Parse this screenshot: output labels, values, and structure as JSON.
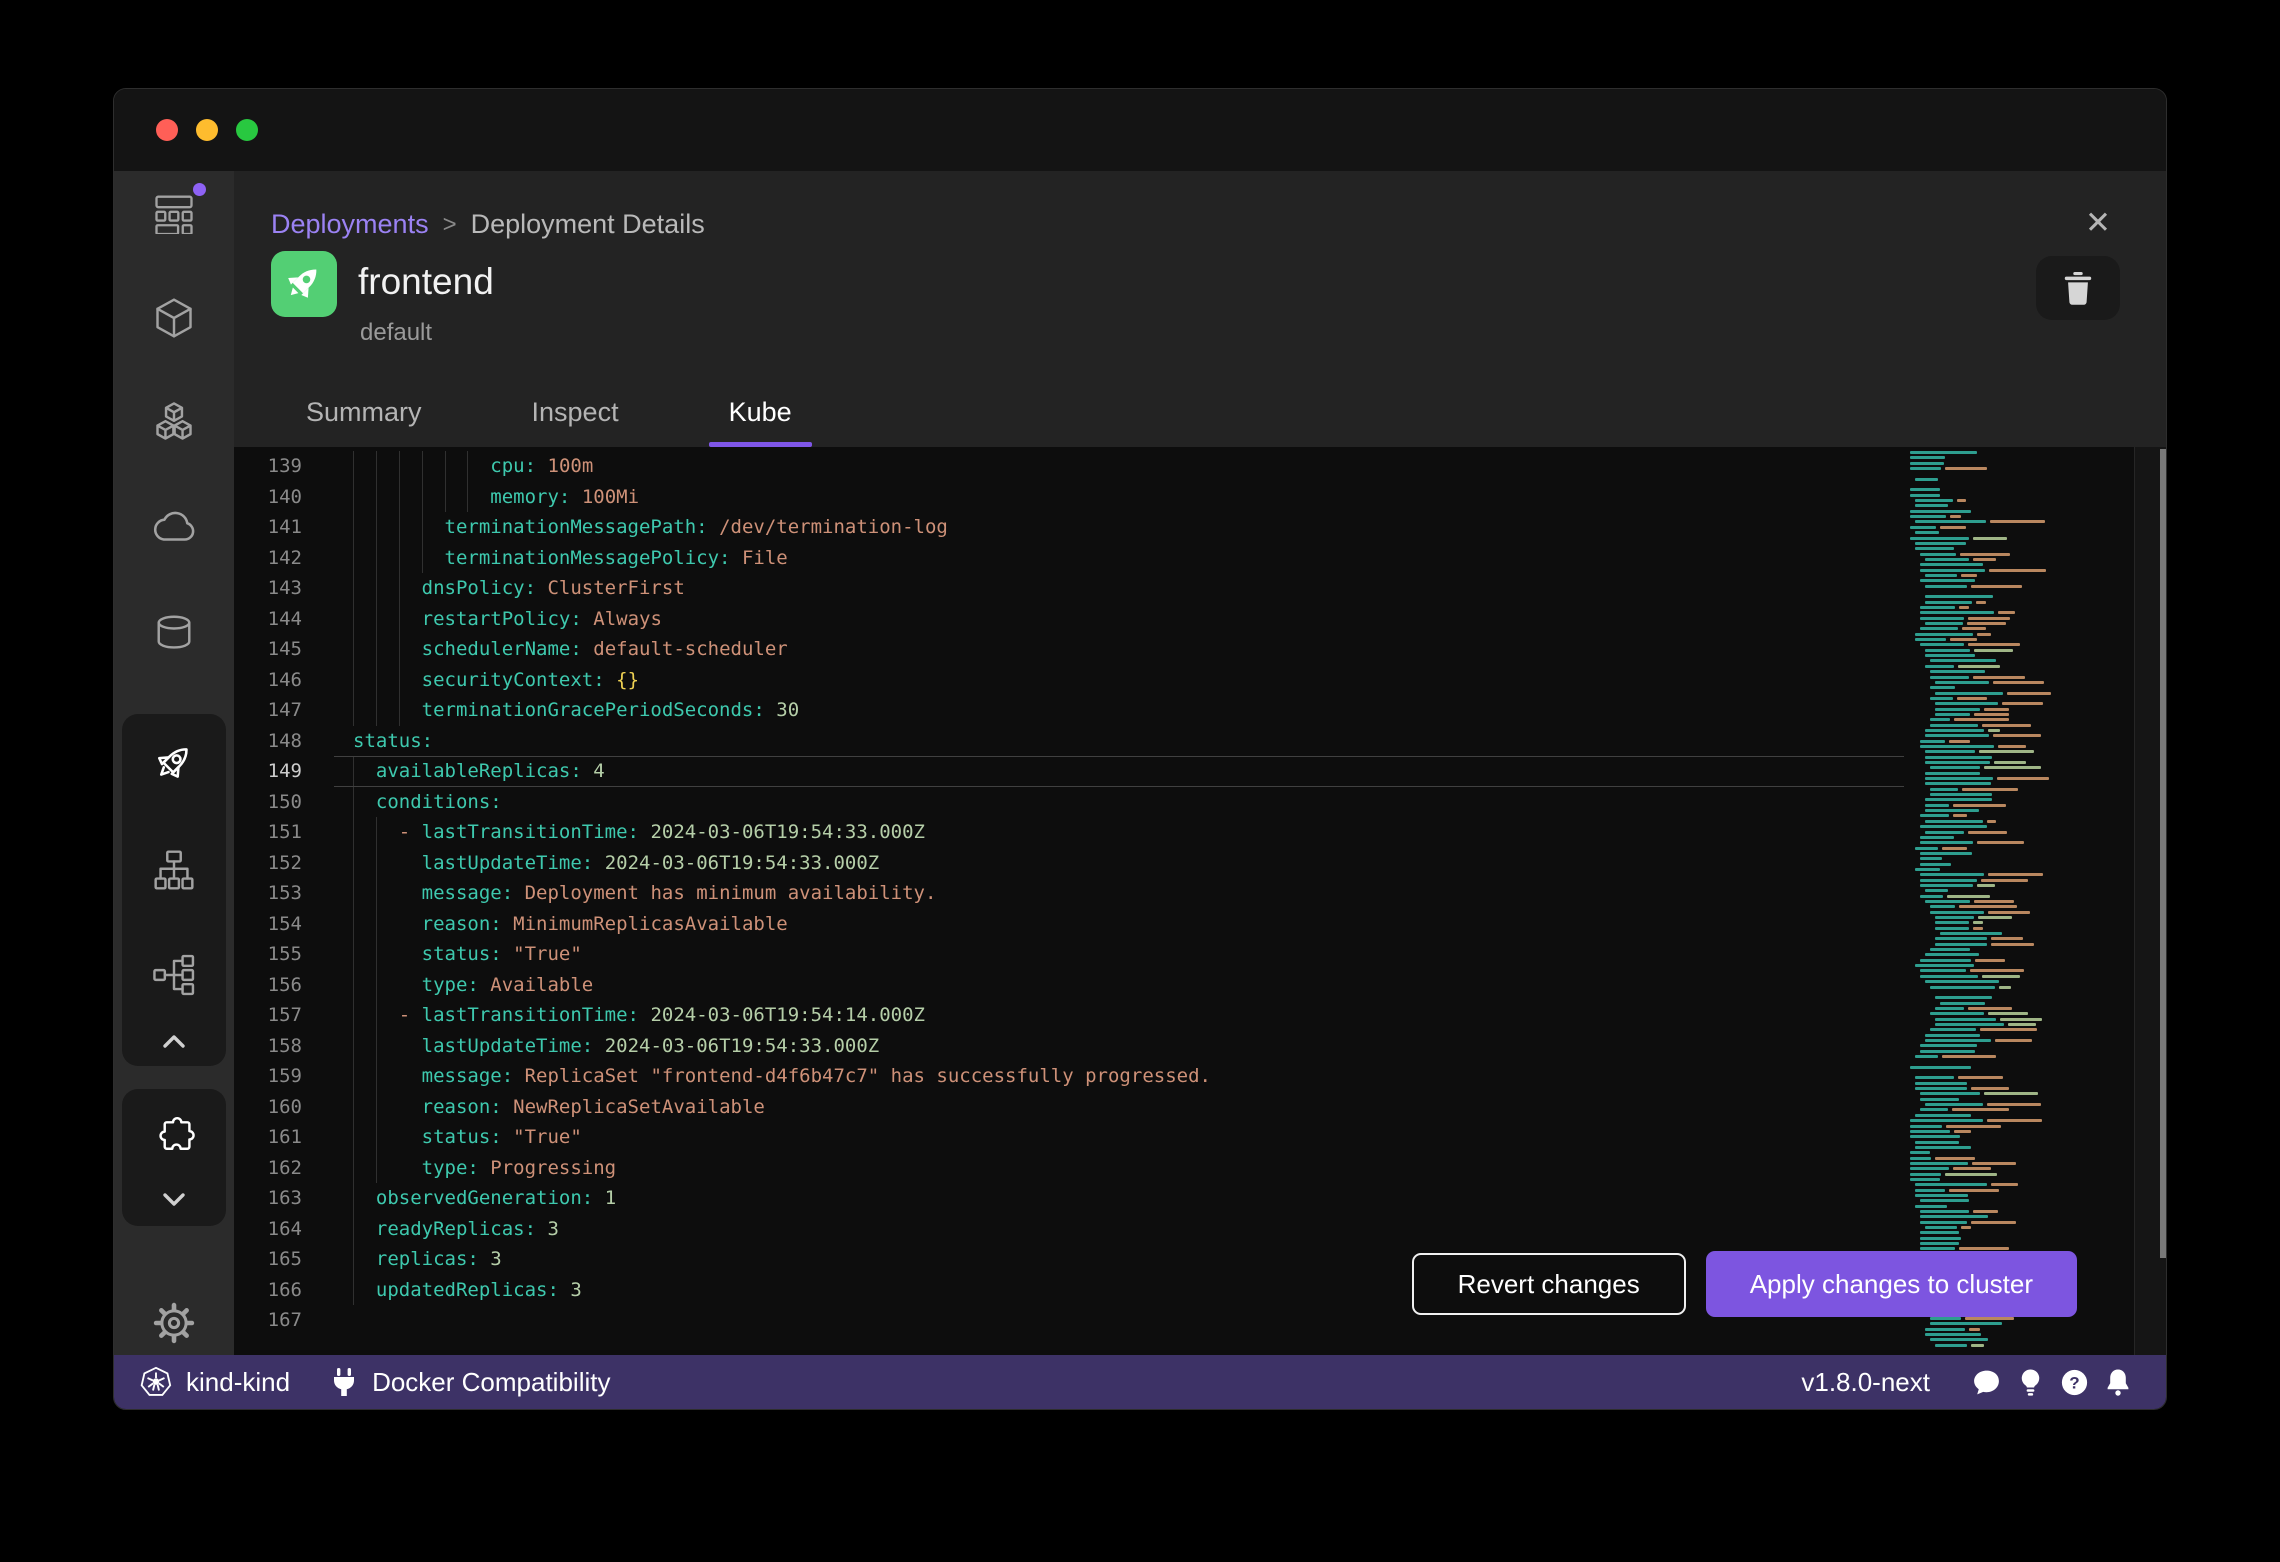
{
  "window": {
    "traffic_lights": {
      "close": "#ff5f57",
      "minimize": "#febc2e",
      "zoom": "#28c840"
    }
  },
  "sidebar": {
    "icons": [
      "dashboard-icon",
      "container-cube-icon",
      "pods-cubes-icon",
      "cloud-icon",
      "volumes-database-icon",
      "rocket-icon",
      "sitemap-icon",
      "network-flow-icon",
      "chevron-up-icon",
      "puzzle-icon",
      "chevron-down-icon",
      "gear-icon"
    ],
    "badge_color": "#8e62f5"
  },
  "breadcrumb": {
    "parent": "Deployments",
    "separator": ">",
    "current": "Deployment Details"
  },
  "close_label": "✕",
  "deployment": {
    "name": "frontend",
    "namespace": "default",
    "icon_bg": "#53cf74"
  },
  "tabs": [
    {
      "label": "Summary",
      "active": false
    },
    {
      "label": "Inspect",
      "active": false
    },
    {
      "label": "Kube",
      "active": true
    }
  ],
  "accent": {
    "purple": "#7f56e8",
    "breadcrumb_purple": "#9b82f3",
    "statusbar_purple": "#3d3266"
  },
  "editor": {
    "syntax_colors": {
      "key": "#3ec9ae",
      "string": "#ce9178",
      "number": "#b5cea8",
      "brace": "#eed153",
      "line_number": "#8a8a8a"
    },
    "lines": [
      {
        "num": 139,
        "indent": 12,
        "guides": [
          0,
          2,
          4,
          6,
          8,
          10
        ],
        "dash": false,
        "key": "cpu",
        "value": "100m",
        "vtype": "str",
        "highlight": false
      },
      {
        "num": 140,
        "indent": 12,
        "guides": [
          0,
          2,
          4,
          6,
          8,
          10
        ],
        "dash": false,
        "key": "memory",
        "value": "100Mi",
        "vtype": "str",
        "highlight": false
      },
      {
        "num": 141,
        "indent": 8,
        "guides": [
          0,
          2,
          4,
          6
        ],
        "dash": false,
        "key": "terminationMessagePath",
        "value": "/dev/termination-log",
        "vtype": "str",
        "highlight": false
      },
      {
        "num": 142,
        "indent": 8,
        "guides": [
          0,
          2,
          4,
          6
        ],
        "dash": false,
        "key": "terminationMessagePolicy",
        "value": "File",
        "vtype": "str",
        "highlight": false
      },
      {
        "num": 143,
        "indent": 6,
        "guides": [
          0,
          2,
          4
        ],
        "dash": false,
        "key": "dnsPolicy",
        "value": "ClusterFirst",
        "vtype": "str",
        "highlight": false
      },
      {
        "num": 144,
        "indent": 6,
        "guides": [
          0,
          2,
          4
        ],
        "dash": false,
        "key": "restartPolicy",
        "value": "Always",
        "vtype": "str",
        "highlight": false
      },
      {
        "num": 145,
        "indent": 6,
        "guides": [
          0,
          2,
          4
        ],
        "dash": false,
        "key": "schedulerName",
        "value": "default-scheduler",
        "vtype": "str",
        "highlight": false
      },
      {
        "num": 146,
        "indent": 6,
        "guides": [
          0,
          2,
          4
        ],
        "dash": false,
        "key": "securityContext",
        "value": "{}",
        "vtype": "brace",
        "highlight": false
      },
      {
        "num": 147,
        "indent": 6,
        "guides": [
          0,
          2,
          4
        ],
        "dash": false,
        "key": "terminationGracePeriodSeconds",
        "value": "30",
        "vtype": "num",
        "highlight": false
      },
      {
        "num": 148,
        "indent": 0,
        "guides": [],
        "dash": false,
        "key": "status",
        "value": "",
        "vtype": "str",
        "highlight": false
      },
      {
        "num": 149,
        "indent": 2,
        "guides": [
          0
        ],
        "dash": false,
        "key": "availableReplicas",
        "value": "4",
        "vtype": "num",
        "highlight": true
      },
      {
        "num": 150,
        "indent": 2,
        "guides": [
          0
        ],
        "dash": false,
        "key": "conditions",
        "value": "",
        "vtype": "str",
        "highlight": false
      },
      {
        "num": 151,
        "indent": 4,
        "guides": [
          0,
          2
        ],
        "dash": true,
        "key": "lastTransitionTime",
        "value": "2024-03-06T19:54:33.000Z",
        "vtype": "num",
        "highlight": false
      },
      {
        "num": 152,
        "indent": 6,
        "guides": [
          0,
          2
        ],
        "dash": false,
        "key": "lastUpdateTime",
        "value": "2024-03-06T19:54:33.000Z",
        "vtype": "num",
        "highlight": false
      },
      {
        "num": 153,
        "indent": 6,
        "guides": [
          0,
          2
        ],
        "dash": false,
        "key": "message",
        "value": "Deployment has minimum availability.",
        "vtype": "str",
        "highlight": false
      },
      {
        "num": 154,
        "indent": 6,
        "guides": [
          0,
          2
        ],
        "dash": false,
        "key": "reason",
        "value": "MinimumReplicasAvailable",
        "vtype": "str",
        "highlight": false
      },
      {
        "num": 155,
        "indent": 6,
        "guides": [
          0,
          2
        ],
        "dash": false,
        "key": "status",
        "value": "\"True\"",
        "vtype": "str",
        "highlight": false
      },
      {
        "num": 156,
        "indent": 6,
        "guides": [
          0,
          2
        ],
        "dash": false,
        "key": "type",
        "value": "Available",
        "vtype": "str",
        "highlight": false
      },
      {
        "num": 157,
        "indent": 4,
        "guides": [
          0,
          2
        ],
        "dash": true,
        "key": "lastTransitionTime",
        "value": "2024-03-06T19:54:14.000Z",
        "vtype": "num",
        "highlight": false
      },
      {
        "num": 158,
        "indent": 6,
        "guides": [
          0,
          2
        ],
        "dash": false,
        "key": "lastUpdateTime",
        "value": "2024-03-06T19:54:33.000Z",
        "vtype": "num",
        "highlight": false
      },
      {
        "num": 159,
        "indent": 6,
        "guides": [
          0,
          2
        ],
        "dash": false,
        "key": "message",
        "value": "ReplicaSet \"frontend-d4f6b47c7\" has successfully progressed.",
        "vtype": "str",
        "highlight": false
      },
      {
        "num": 160,
        "indent": 6,
        "guides": [
          0,
          2
        ],
        "dash": false,
        "key": "reason",
        "value": "NewReplicaSetAvailable",
        "vtype": "str",
        "highlight": false
      },
      {
        "num": 161,
        "indent": 6,
        "guides": [
          0,
          2
        ],
        "dash": false,
        "key": "status",
        "value": "\"True\"",
        "vtype": "str",
        "highlight": false
      },
      {
        "num": 162,
        "indent": 6,
        "guides": [
          0,
          2
        ],
        "dash": false,
        "key": "type",
        "value": "Progressing",
        "vtype": "str",
        "highlight": false
      },
      {
        "num": 163,
        "indent": 2,
        "guides": [
          0
        ],
        "dash": false,
        "key": "observedGeneration",
        "value": "1",
        "vtype": "num",
        "highlight": false
      },
      {
        "num": 164,
        "indent": 2,
        "guides": [
          0
        ],
        "dash": false,
        "key": "readyReplicas",
        "value": "3",
        "vtype": "num",
        "highlight": false
      },
      {
        "num": 165,
        "indent": 2,
        "guides": [
          0
        ],
        "dash": false,
        "key": "replicas",
        "value": "3",
        "vtype": "num",
        "highlight": false
      },
      {
        "num": 166,
        "indent": 2,
        "guides": [
          0
        ],
        "dash": false,
        "key": "updatedReplicas",
        "value": "3",
        "vtype": "num",
        "highlight": false
      },
      {
        "num": 167,
        "indent": 0,
        "guides": [],
        "dash": false,
        "key": "",
        "value": "",
        "vtype": "str",
        "highlight": false
      }
    ]
  },
  "minimap": {
    "line_count": 168,
    "colors": {
      "key": "#2e9e8f",
      "string": "#b9875f",
      "number": "#9fb586"
    }
  },
  "actions": {
    "revert": "Revert changes",
    "apply": "Apply changes to cluster"
  },
  "statusbar": {
    "context": "kind-kind",
    "compatibility": "Docker Compatibility",
    "version": "v1.8.0-next",
    "right_icons": [
      "feedback-chat-icon",
      "tips-lightbulb-icon",
      "help-icon",
      "notifications-bell-icon"
    ]
  }
}
